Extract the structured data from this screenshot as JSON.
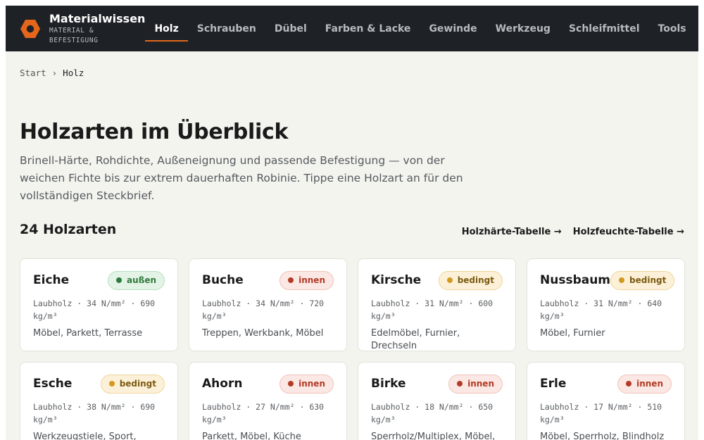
{
  "header": {
    "brand_name": "Materialwissen",
    "brand_sub": "MATERIAL & BEFESTIGUNG",
    "logo_icon": "hex-nut-icon",
    "accent": "#e4661b",
    "nav": [
      {
        "label": "Holz",
        "active": true
      },
      {
        "label": "Schrauben"
      },
      {
        "label": "Dübel"
      },
      {
        "label": "Farben & Lacke"
      },
      {
        "label": "Gewinde"
      },
      {
        "label": "Werkzeug"
      },
      {
        "label": "Schleifmittel"
      },
      {
        "label": "Tools"
      }
    ]
  },
  "breadcrumb": {
    "start": "Start",
    "separator": "›",
    "current": "Holz"
  },
  "main": {
    "title": "Holzarten im Überblick",
    "description": "Brinell-Härte, Rohdichte, Außeneignung und passende Befestigung — von der weichen Fichte bis zur extrem dauerhaften Robinie. Tippe eine Holzart an für den vollständigen Steckbrief.",
    "count": "24 Holzarten",
    "links": [
      "Holzhärte-Tabelle →",
      "Holzfeuchte-Tabelle →"
    ]
  },
  "cards": [
    {
      "name": "Eiche",
      "badge": "außen",
      "badge_color": "green",
      "spec": "Laubholz · 34 N/mm² · 690 kg/m³",
      "uses": "Möbel, Parkett, Terrasse"
    },
    {
      "name": "Buche",
      "badge": "innen",
      "badge_color": "red",
      "spec": "Laubholz · 34 N/mm² · 720 kg/m³",
      "uses": "Treppen, Werkbank, Möbel"
    },
    {
      "name": "Kirsche",
      "badge": "bedingt",
      "badge_color": "yellow",
      "spec": "Laubholz · 31 N/mm² · 600 kg/m³",
      "uses": "Edelmöbel, Furnier, Drechseln"
    },
    {
      "name": "Nussbaum",
      "badge": "bedingt",
      "badge_color": "yellow",
      "spec": "Laubholz · 31 N/mm² · 640 kg/m³",
      "uses": "Möbel, Furnier"
    },
    {
      "name": "Esche",
      "badge": "bedingt",
      "badge_color": "yellow",
      "spec": "Laubholz · 38 N/mm² · 690 kg/m³",
      "uses": "Werkzeugstiele, Sport, Möbel"
    },
    {
      "name": "Ahorn",
      "badge": "innen",
      "badge_color": "red",
      "spec": "Laubholz · 27 N/mm² · 630 kg/m³",
      "uses": "Parkett, Möbel, Küche"
    },
    {
      "name": "Birke",
      "badge": "innen",
      "badge_color": "red",
      "spec": "Laubholz · 18 N/mm² · 650 kg/m³",
      "uses": "Sperrholz/Multiplex, Möbel,"
    },
    {
      "name": "Erle",
      "badge": "innen",
      "badge_color": "red",
      "spec": "Laubholz · 17 N/mm² · 510 kg/m³",
      "uses": "Möbel, Sperrholz, Blindholz"
    }
  ]
}
